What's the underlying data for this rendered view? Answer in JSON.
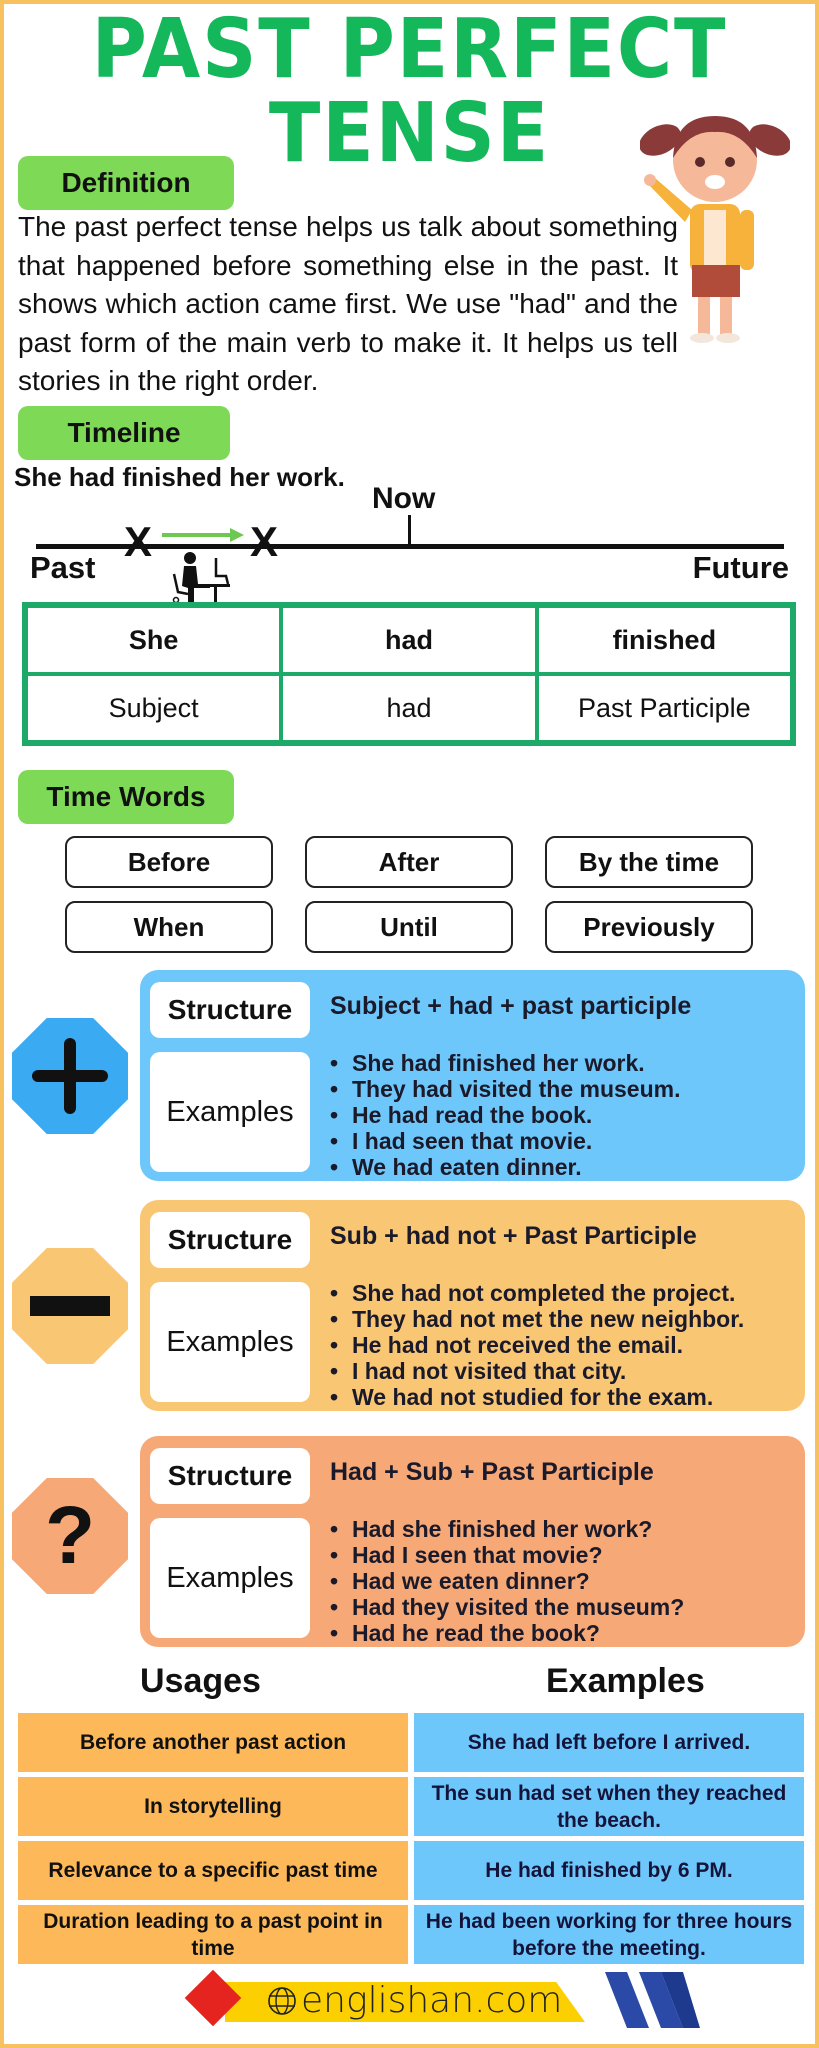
{
  "title": {
    "line1": "PAST PERFECT",
    "line2": "TENSE"
  },
  "definition": {
    "label": "Definition",
    "text": "The past perfect tense helps us talk about something that happened before something else in the past. It shows which action came first. We use \"had\" and the past form of the main verb to make it. It helps us tell stories in the right order."
  },
  "timeline": {
    "label": "Timeline",
    "sentence": "She had finished her work.",
    "now_label": "Now",
    "past_label": "Past",
    "future_label": "Future",
    "marker": "X"
  },
  "formula": {
    "headers": [
      "She",
      "had",
      "finished"
    ],
    "parts": [
      "Subject",
      "had",
      "Past Participle"
    ]
  },
  "time_words": {
    "label": "Time Words",
    "items": [
      "Before",
      "After",
      "By the time",
      "When",
      "Until",
      "Previously"
    ]
  },
  "forms": [
    {
      "type": "positive",
      "icon": "plus-icon",
      "color": "#6ec7fb",
      "icon_color": "#3aaaf2",
      "structure_label": "Structure",
      "structure": "Subject + had + past participle",
      "examples_label": "Examples",
      "examples": [
        "She had finished her work.",
        "They had visited the museum.",
        "He had read the book.",
        "I had seen that movie.",
        "We had eaten dinner."
      ]
    },
    {
      "type": "negative",
      "icon": "minus-icon",
      "color": "#f9c673",
      "icon_color": "#f9c673",
      "structure_label": "Structure",
      "structure": "Sub + had not + Past Participle",
      "examples_label": "Examples",
      "examples": [
        "She had not completed the project.",
        "They had not met the new neighbor.",
        "He had not received the email.",
        "I had not visited that city.",
        "We had not studied for the exam."
      ]
    },
    {
      "type": "question",
      "icon": "question-icon",
      "color": "#f7a877",
      "icon_color": "#f7a877",
      "structure_label": "Structure",
      "structure": "Had + Sub + Past Participle",
      "examples_label": "Examples",
      "examples": [
        "Had she finished her work?",
        "Had I seen that movie?",
        "Had we eaten dinner?",
        "Had they visited the museum?",
        "Had he read the book?"
      ]
    }
  ],
  "usages": {
    "usage_header": "Usages",
    "examples_header": "Examples",
    "rows": [
      {
        "usage": "Before another past action",
        "example": "She had left before I arrived."
      },
      {
        "usage": "In storytelling",
        "example": "The sun had set when they reached the beach."
      },
      {
        "usage": "Relevance to a specific past time",
        "example": "He had finished by 6 PM."
      },
      {
        "usage": "Duration leading to a past point in time",
        "example": "He had been working for three hours before the meeting."
      }
    ]
  },
  "footer": {
    "site": "englishan.com"
  }
}
